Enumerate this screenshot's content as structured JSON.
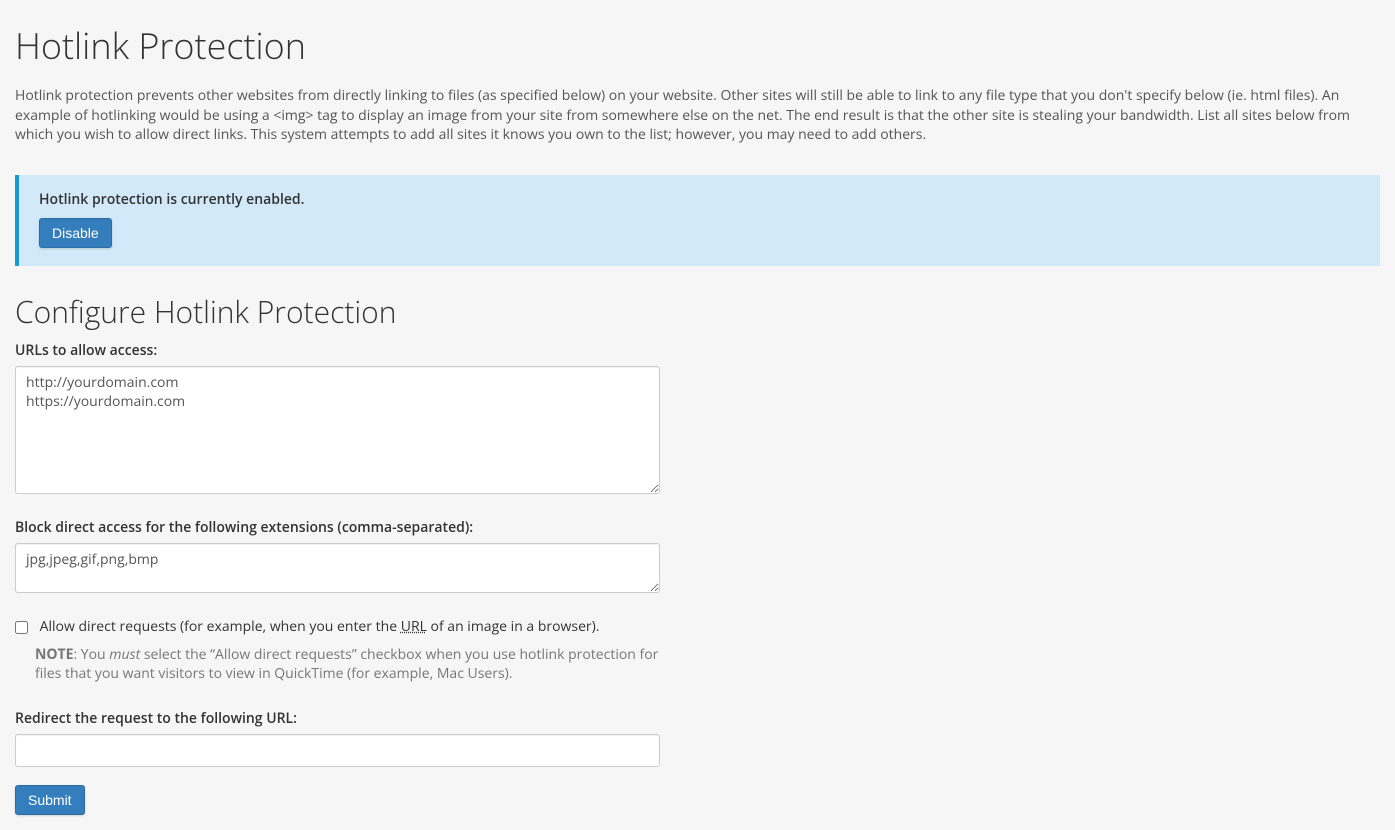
{
  "page": {
    "title": "Hotlink Protection",
    "description": "Hotlink protection prevents other websites from directly linking to files (as specified below) on your website. Other sites will still be able to link to any file type that you don't specify below (ie. html files). An example of hotlinking would be using a <img> tag to display an image from your site from somewhere else on the net. The end result is that the other site is stealing your bandwidth. List all sites below from which you wish to allow direct links. This system attempts to add all sites it knows you own to the list; however, you may need to add others."
  },
  "alert": {
    "status_text": "Hotlink protection is currently enabled.",
    "disable_label": "Disable"
  },
  "form": {
    "heading": "Configure Hotlink Protection",
    "urls_label": "URLs to allow access:",
    "urls_value": "http://yourdomain.com\nhttps://yourdomain.com",
    "extensions_label": "Block direct access for the following extensions (comma-separated):",
    "extensions_value": "jpg,jpeg,gif,png,bmp",
    "allow_direct_pre": "Allow direct requests (for example, when you enter the ",
    "allow_direct_abbr": "URL",
    "allow_direct_post": " of an image in a browser).",
    "note_label": "NOTE",
    "note_pre": ": You ",
    "note_em": "must",
    "note_post": " select the “Allow direct requests” checkbox when you use hotlink protection for files that you want visitors to view in QuickTime (for example, Mac Users).",
    "redirect_label": "Redirect the request to the following URL:",
    "redirect_value": "",
    "submit_label": "Submit"
  }
}
